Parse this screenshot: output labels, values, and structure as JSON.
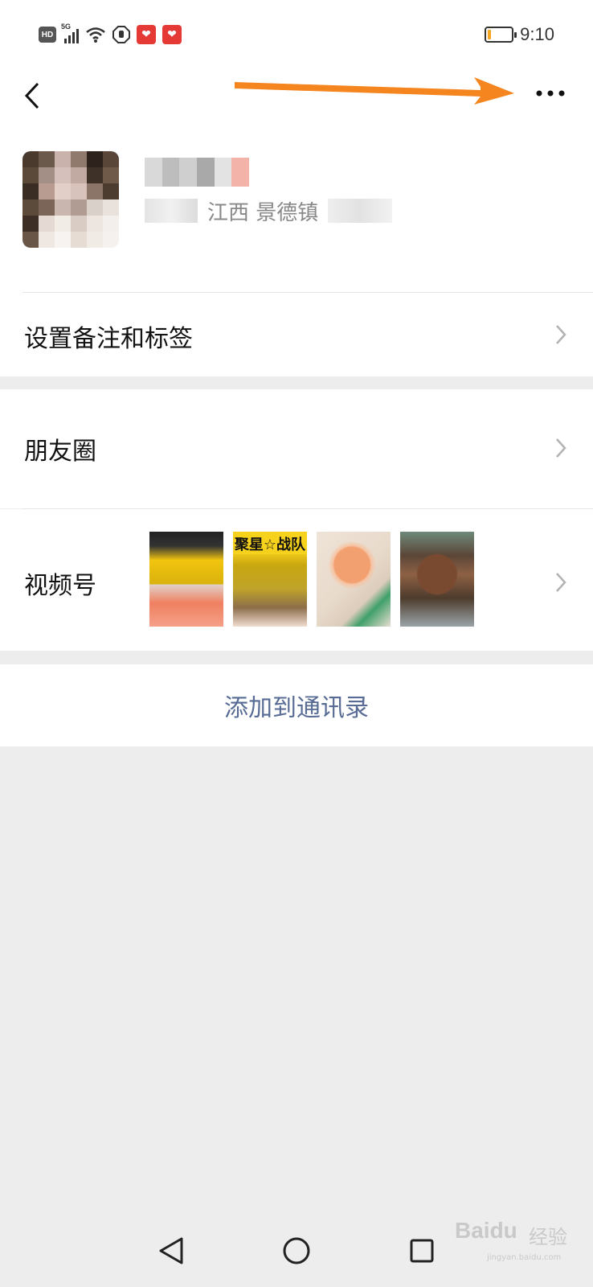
{
  "status_bar": {
    "hd": "HD",
    "network": "5G",
    "time": "9:10",
    "battery_level": 0.15
  },
  "navbar": {
    "back_icon": "chevron-left-icon",
    "more_icon": "more-dots-icon",
    "annotation_color": "#f5861f"
  },
  "profile": {
    "region": "江西 景德镇"
  },
  "rows": {
    "remark_label": "设置备注和标签",
    "moments_label": "朋友圈",
    "channels_label": "视频号"
  },
  "channels_thumbs": [
    {
      "caption": ""
    },
    {
      "caption": "聚星☆战队"
    },
    {
      "caption": ""
    },
    {
      "caption": ""
    }
  ],
  "actions": {
    "add_contact_label": "添加到通讯录"
  },
  "system_nav": {
    "back_icon": "triangle-back-icon",
    "home_icon": "circle-home-icon",
    "recents_icon": "square-recents-icon"
  },
  "watermark": {
    "brand": "Baidu",
    "cn": "经验",
    "url": "jingyan.baidu.com"
  },
  "colors": {
    "link": "#576b95",
    "background": "#ededed"
  }
}
